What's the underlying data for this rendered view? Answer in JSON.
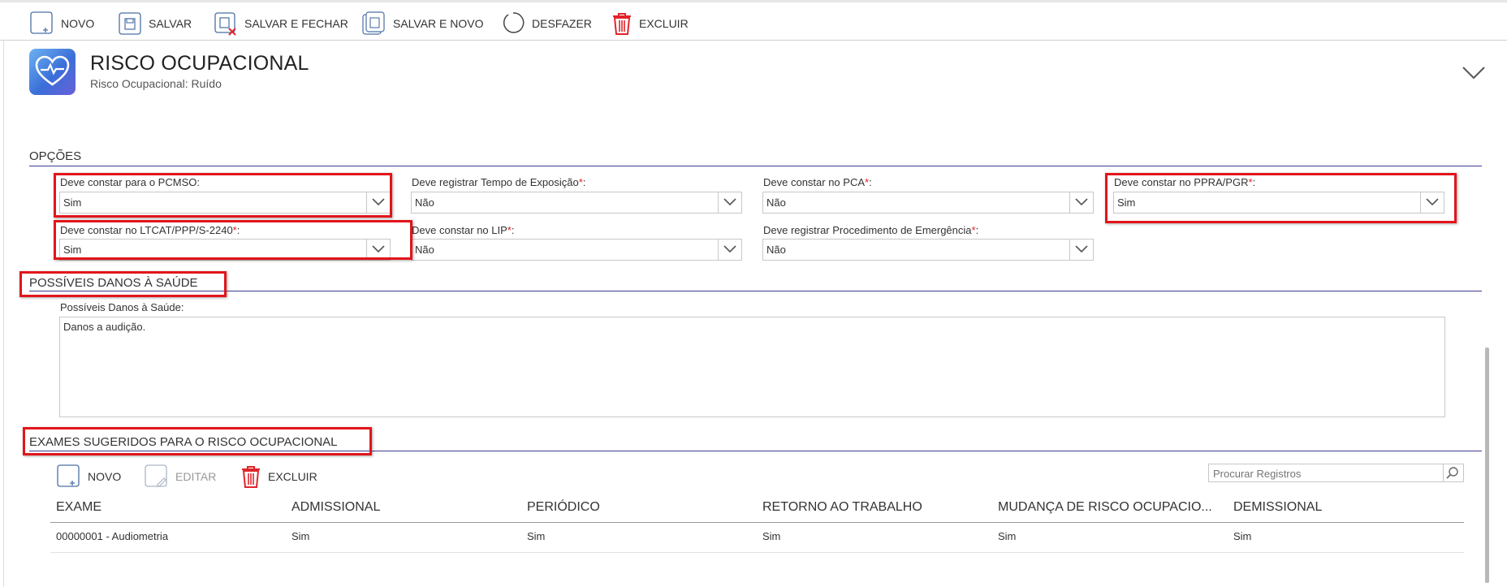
{
  "toolbar": {
    "novo": "NOVO",
    "salvar": "SALVAR",
    "salvar_fechar": "SALVAR E FECHAR",
    "salvar_novo": "SALVAR E NOVO",
    "desfazer": "DESFAZER",
    "excluir": "EXCLUIR"
  },
  "header": {
    "title": "RISCO OCUPACIONAL",
    "subtitle": "Risco Ocupacional: Ruído"
  },
  "opcoes": {
    "title": "OPÇÕES",
    "fields": [
      {
        "label": "Deve constar para o PCMSO:",
        "required": "",
        "value": "Sim"
      },
      {
        "label": "Deve registrar Tempo de Exposição",
        "required": "*",
        "value": "Não"
      },
      {
        "label": "Deve constar no PCA",
        "required": "*",
        "value": "Não"
      },
      {
        "label": "Deve constar no PPRA/PGR",
        "required": "*",
        "value": "Sim"
      },
      {
        "label": "Deve constar no LTCAT/PPP/S-2240",
        "required": "*",
        "value": "Sim"
      },
      {
        "label": "Deve constar no LIP",
        "required": "*",
        "value": "Não"
      },
      {
        "label": "Deve registrar Procedimento de Emergência",
        "required": "*",
        "value": "Não"
      }
    ],
    "colon": ":"
  },
  "danos": {
    "title": "POSSÍVEIS DANOS À SAÚDE",
    "label": "Possíveis Danos à Saúde:",
    "value": "Danos a audição."
  },
  "exames": {
    "title": "EXAMES SUGERIDOS PARA O RISCO OCUPACIONAL",
    "novo": "NOVO",
    "editar": "EDITAR",
    "excluir": "EXCLUIR",
    "search_placeholder": "Procurar Registros",
    "columns": [
      "EXAME",
      "ADMISSIONAL",
      "PERIÓDICO",
      "RETORNO AO TRABALHO",
      "MUDANÇA DE RISCO OCUPACIO...",
      "DEMISSIONAL"
    ],
    "rows": [
      [
        "00000001 - Audiometria",
        "Sim",
        "Sim",
        "Sim",
        "Sim",
        "Sim"
      ]
    ]
  },
  "colors": {
    "accent_rule": "#3c3a8c",
    "highlight": "#e2151b",
    "required": "#e02020",
    "delete_icon": "#e0252b"
  }
}
